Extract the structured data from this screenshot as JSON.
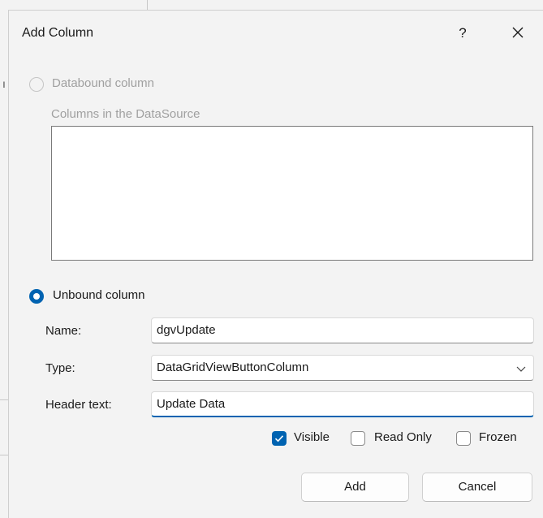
{
  "dialog": {
    "title": "Add Column",
    "help_label": "?",
    "close_icon": "close-icon"
  },
  "databound": {
    "radio_label": "Databound column",
    "selected": false,
    "columns_label": "Columns in the DataSource"
  },
  "unbound": {
    "radio_label": "Unbound column",
    "selected": true,
    "name_label": "Name:",
    "name_value": "dgvUpdate",
    "type_label": "Type:",
    "type_value": "DataGridViewButtonColumn",
    "header_label": "Header text:",
    "header_value": "Update Data"
  },
  "options": {
    "visible_label": "Visible",
    "visible_checked": true,
    "readonly_label": "Read Only",
    "readonly_checked": false,
    "frozen_label": "Frozen",
    "frozen_checked": false
  },
  "buttons": {
    "add_label": "Add",
    "cancel_label": "Cancel"
  },
  "colors": {
    "accent": "#0063b1",
    "disabled_text": "#a0a0a0",
    "background": "#f3f3f3"
  }
}
